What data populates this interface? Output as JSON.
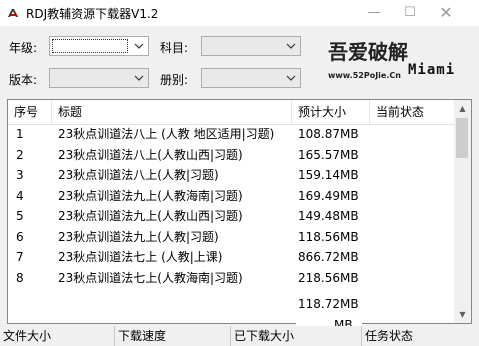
{
  "window": {
    "title": "RDJ教辅资源下载器V1.2",
    "min_label": "—",
    "max_label": "☐",
    "close_label": "✕"
  },
  "filters": {
    "grade_label": "年级:",
    "subject_label": "科目:",
    "edition_label": "版本:",
    "volume_label": "册别:",
    "grade_value": "",
    "subject_value": "",
    "edition_value": "",
    "volume_value": ""
  },
  "logo": {
    "mark": "吾爱破解",
    "url": "www.52PoJie.Cn",
    "name": "Miami"
  },
  "table": {
    "headers": [
      "序号",
      "标题",
      "预计大小",
      "当前状态"
    ],
    "rows": [
      {
        "no": "1",
        "title": "23秋点训道法八上 (人教 地区适用|习题)",
        "size": "108.87MB",
        "state": ""
      },
      {
        "no": "2",
        "title": "23秋点训道法八上(人教山西|习题)",
        "size": "165.57MB",
        "state": ""
      },
      {
        "no": "3",
        "title": "23秋点训道法八上(人教|习题)",
        "size": "159.14MB",
        "state": ""
      },
      {
        "no": "4",
        "title": "23秋点训道法九上(人教海南|习题)",
        "size": "169.49MB",
        "state": ""
      },
      {
        "no": "5",
        "title": "23秋点训道法九上(人教山西|习题)",
        "size": "149.48MB",
        "state": ""
      },
      {
        "no": "6",
        "title": "23秋点训道法九上(人教|习题)",
        "size": "118.56MB",
        "state": ""
      },
      {
        "no": "7",
        "title": "23秋点训道法七上 (人教|上课)",
        "size": "866.72MB",
        "state": ""
      },
      {
        "no": "8",
        "title": "23秋点训道法七上(人教海南|习题)",
        "size": "218.56MB",
        "state": ""
      }
    ],
    "overflow_sizes": [
      "118.72MB",
      "MB"
    ]
  },
  "status": {
    "file_size_label": "文件大小",
    "speed_label": "下载速度",
    "downloaded_label": "已下载大小",
    "task_state_label": "任务状态"
  },
  "colors": {
    "window_bg": "#f0f0f0",
    "list_bg": "#ffffff",
    "border": "#828790"
  }
}
